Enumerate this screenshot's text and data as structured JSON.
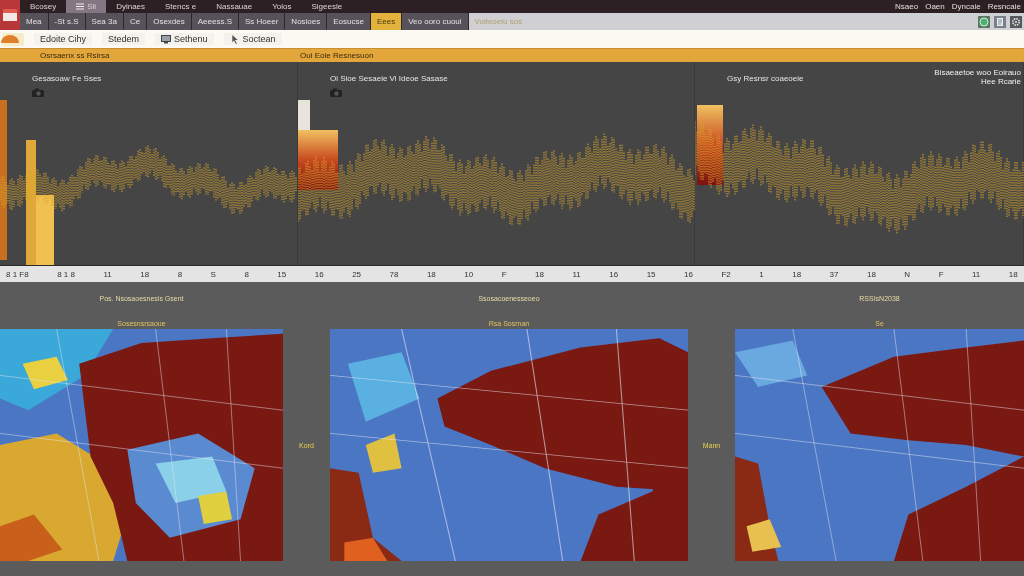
{
  "app_bar": {
    "menu": [
      {
        "label": "Bcosey",
        "kind": "text",
        "selected": false
      },
      {
        "label": "Sli",
        "kind": "list",
        "selected": true
      },
      {
        "label": "Dyinaes",
        "kind": "text",
        "selected": false
      },
      {
        "label": "Stencs e",
        "kind": "text",
        "selected": false
      },
      {
        "label": "Nassauae",
        "kind": "text",
        "selected": false
      },
      {
        "label": "Yolos",
        "kind": "text",
        "selected": false
      },
      {
        "label": "Sigeesle",
        "kind": "text",
        "selected": false
      }
    ],
    "status": [
      "Nsaeo",
      "Oaen",
      "Dyncaie",
      "Resncaie"
    ]
  },
  "tab_bar": {
    "tabs": [
      {
        "label": "Mea",
        "selected": false
      },
      {
        "label": "-St s.S",
        "selected": false
      },
      {
        "label": "Sea 3a",
        "selected": false
      },
      {
        "label": "Ce",
        "selected": false
      },
      {
        "label": "Osexdes",
        "selected": false
      },
      {
        "label": "Aeeess.S",
        "selected": false
      },
      {
        "label": "Ss Hoeer",
        "selected": false
      },
      {
        "label": "Nosioes",
        "selected": false
      },
      {
        "label": "Eosucse",
        "selected": false
      },
      {
        "label": "Eees",
        "selected": true
      },
      {
        "label": "Veo ooro cuoui",
        "selected": false
      }
    ],
    "note": "Voiteoeiu sos"
  },
  "toolbar": {
    "items": [
      {
        "label": "Edoite Cihy",
        "kind": "text"
      },
      {
        "label": "Stedem",
        "kind": "text"
      },
      {
        "label": "Sethenu",
        "kind": "monitor"
      },
      {
        "label": "Soctean",
        "kind": "cursor"
      }
    ]
  },
  "chart_header": {
    "left": "Osrsaenx ss Rsirsa",
    "right": "Oui Eoie Resnesuon"
  },
  "panels": [
    {
      "title": "Gesasoaw Fe Sses",
      "camera": true
    },
    {
      "title": "Oi Sioe Sesaeie Vi Ideoe Sasase",
      "camera": true
    },
    {
      "title": "Gsy Resnsr coaeoeie",
      "camera": false,
      "note": [
        "Bisaeaetoe woo Eoirauo",
        "Hee Rcarie"
      ]
    }
  ],
  "time_axis": {
    "ticks": [
      "8 1 F8",
      "8 1 8",
      "11",
      "18",
      "8",
      "S",
      "8",
      "15",
      "16",
      "25",
      "78",
      "18",
      "10",
      "F",
      "18",
      "11",
      "16",
      "15",
      "16",
      "F2",
      "1",
      "18",
      "37",
      "18",
      "N",
      "F",
      "11",
      "18"
    ]
  },
  "captions": [
    "Pos. Nsosaoesnesis Gsent",
    "Ssosacoenesseoeo",
    "RSSIsN2038"
  ],
  "maps": [
    {
      "title": "Sosesnsrsaoue"
    },
    {
      "title": "Rsa Sosrnan",
      "side_label": "Kord"
    },
    {
      "title": "Se",
      "side_label": "Mann"
    }
  ]
}
